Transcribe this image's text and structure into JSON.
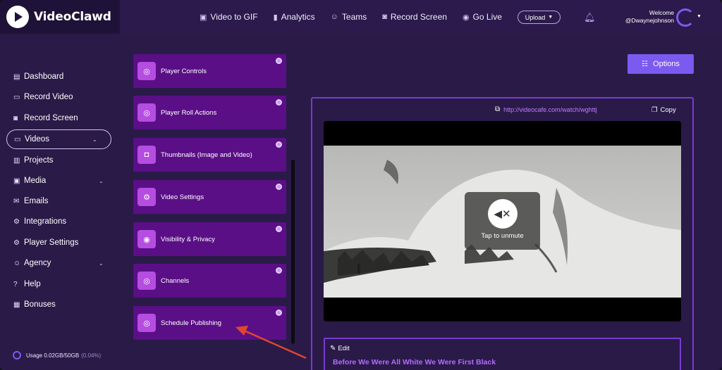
{
  "brand": {
    "name": "VideoClawd"
  },
  "topnav": [
    {
      "label": "Video to GIF",
      "icon": "gif-icon"
    },
    {
      "label": "Analytics",
      "icon": "bar-chart-icon"
    },
    {
      "label": "Teams",
      "icon": "team-icon"
    },
    {
      "label": "Record Screen",
      "icon": "record-icon"
    },
    {
      "label": "Go Live",
      "icon": "broadcast-icon"
    }
  ],
  "upload_label": "Upload",
  "user": {
    "welcome": "Welcome",
    "handle": "@Dwaynejohnson"
  },
  "sidebar": {
    "items": [
      {
        "label": "Dashboard"
      },
      {
        "label": "Record Video"
      },
      {
        "label": "Record Screen"
      },
      {
        "label": "Videos"
      },
      {
        "label": "Projects"
      },
      {
        "label": "Media"
      },
      {
        "label": "Emails"
      },
      {
        "label": "Integrations"
      },
      {
        "label": "Player Settings"
      },
      {
        "label": "Agency"
      },
      {
        "label": "Help"
      },
      {
        "label": "Bonuses"
      }
    ],
    "usage": {
      "label": "Usage 0.02GB/50GB",
      "percent": "(0.04%)"
    }
  },
  "menu_cards": [
    {
      "label": "Player Controls"
    },
    {
      "label": "Player Roll Actions"
    },
    {
      "label": "Thumbnails (Image and Video)"
    },
    {
      "label": "Video Settings"
    },
    {
      "label": "Visibility & Privacy"
    },
    {
      "label": "Channels"
    },
    {
      "label": "Schedule Publishing"
    }
  ],
  "options_label": "Options",
  "video_panel": {
    "url": "http://videocafe.com/watch/wghttj",
    "copy_label": "Copy",
    "unmute_label": "Tap to unmute",
    "edit_label": "Edit",
    "title": "Before We Were All White We Were First Black"
  },
  "colors": {
    "background": "#2a1a48",
    "card": "#5a0f86",
    "accent": "#7b5af0",
    "link": "#c27bff",
    "arrow": "#e2452e"
  }
}
